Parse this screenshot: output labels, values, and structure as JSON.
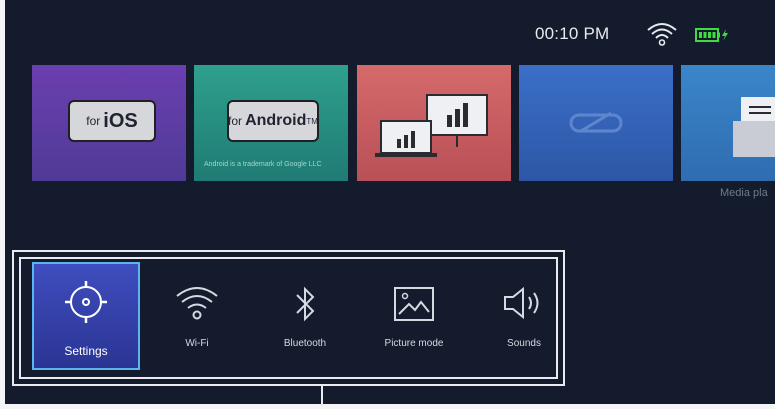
{
  "status_bar": {
    "time": "00:10 PM",
    "wifi_icon": "wifi-icon",
    "battery_icon": "battery-charging-icon",
    "battery_color": "#3fdc3f"
  },
  "tiles": [
    {
      "name": "ios",
      "prefix": "for",
      "label": "iOS"
    },
    {
      "name": "android",
      "prefix": "for",
      "label": "Android",
      "trademark": "TM",
      "note": "Android is a trademark of Google LLC"
    },
    {
      "name": "screen-cast",
      "icon": "presentation-icon"
    },
    {
      "name": "link",
      "icon": "link-icon"
    },
    {
      "name": "media-player",
      "icon": "folder-icon",
      "label": "Media pla"
    }
  ],
  "dock": {
    "items": [
      {
        "label": "Settings",
        "icon": "settings-icon",
        "selected": true
      },
      {
        "label": "Wi-Fi",
        "icon": "wifi-icon"
      },
      {
        "label": "Bluetooth",
        "icon": "bluetooth-icon"
      },
      {
        "label": "Picture mode",
        "icon": "picture-icon"
      },
      {
        "label": "Sounds",
        "icon": "speaker-icon"
      }
    ]
  },
  "colors": {
    "background": "#131b2c",
    "selection_border": "#5ab6f0",
    "selection_fill": "#3a46b2"
  }
}
